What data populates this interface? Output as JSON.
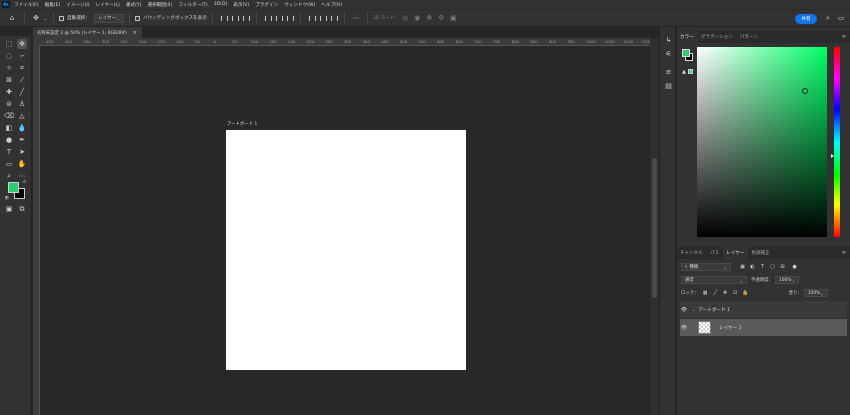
{
  "app": {
    "logo": "Ps"
  },
  "menu": [
    "ファイル(F)",
    "編集(E)",
    "イメージ(I)",
    "レイヤー(L)",
    "書式(Y)",
    "選択範囲(S)",
    "フィルター(T)",
    "3D(D)",
    "表示(V)",
    "プラグイン",
    "ウィンドウ(W)",
    "ヘルプ(H)"
  ],
  "options": {
    "auto_select_label": "自動選択：",
    "auto_select_target": "レイヤー",
    "show_transform_label": "バウンディングボックスを表示",
    "mode_3d_label": "3D モード：",
    "share_label": "共有"
  },
  "document": {
    "tab_title": "名称未設定 2 @ 50% (レイヤー 1, RGB/8#)",
    "close_glyph": "×",
    "ruler_ticks": [
      "450",
      "400",
      "350",
      "300",
      "250",
      "200",
      "150",
      "100",
      "50",
      "0",
      "50",
      "100",
      "150",
      "200",
      "250",
      "300",
      "350",
      "400",
      "450",
      "500",
      "550",
      "600",
      "650",
      "700",
      "750",
      "800",
      "850",
      "900",
      "950",
      "1000",
      "1050",
      "1100",
      "1150"
    ],
    "artboard_label": "アートボード 1"
  },
  "color_panel": {
    "tabs": [
      "カラー",
      "グラデーション",
      "パターン"
    ],
    "active_tab": "カラー",
    "foreground_color": "#2ecc71",
    "background_color": "#000000",
    "warning_glyph": "▲"
  },
  "layers_panel": {
    "tabs": [
      "チャンネル",
      "パス",
      "レイヤー",
      "色調補正"
    ],
    "active_tab": "レイヤー",
    "filter_kind": "種類",
    "blend_mode": "通常",
    "opacity_label": "不透明度：",
    "opacity_value": "100%",
    "lock_label": "ロック：",
    "fill_label": "塗り：",
    "fill_value": "100%",
    "layers": [
      {
        "name": "アートボード 1",
        "type": "artboard",
        "visible": true
      },
      {
        "name": "レイヤー 1",
        "type": "pixel",
        "visible": true,
        "selected": true
      }
    ]
  },
  "colors": {
    "accent": "#1473e6",
    "app_bg": "#262626",
    "panel_bg": "#323232",
    "canvas_bg": "#282828",
    "artboard_fill": "#ffffff"
  }
}
